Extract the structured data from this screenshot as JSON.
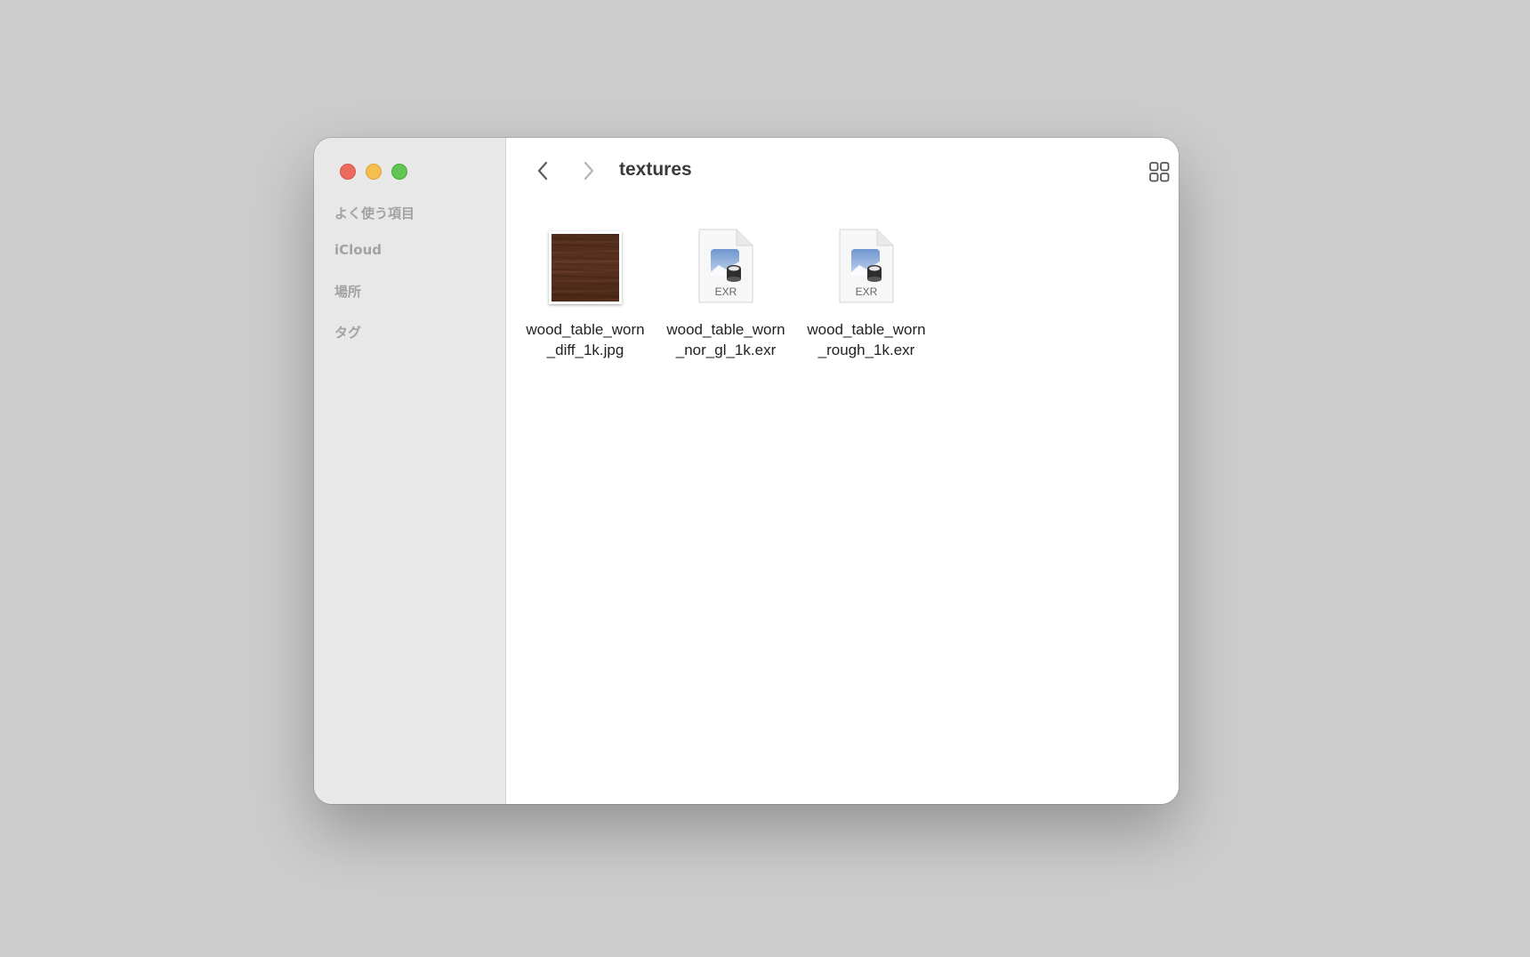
{
  "window": {
    "title": "textures"
  },
  "sidebar": {
    "sections": [
      {
        "label": "よく使う項目"
      },
      {
        "label": "iCloud"
      },
      {
        "label": "場所"
      },
      {
        "label": "タグ"
      }
    ]
  },
  "toolbar": {
    "icons": [
      "back-icon",
      "forward-icon",
      "icon-view-icon",
      "group-by-icon",
      "share-icon",
      "more-icon",
      "search-icon"
    ]
  },
  "files": [
    {
      "name_line1": "wood_table_worn",
      "name_line2": "_diff_1k.jpg",
      "kind": "jpg-thumbnail"
    },
    {
      "name_line1": "wood_table_worn",
      "name_line2": "_nor_gl_1k.exr",
      "kind": "exr",
      "badge": "EXR"
    },
    {
      "name_line1": "wood_table_worn",
      "name_line2": "_rough_1k.exr",
      "kind": "exr",
      "badge": "EXR"
    }
  ],
  "colors": {
    "desktop": "#cdcdcd",
    "sidebar": "#e8e8e8",
    "close": "#ed6a5e",
    "minimize": "#f5bf4f",
    "maximize": "#61c554"
  }
}
